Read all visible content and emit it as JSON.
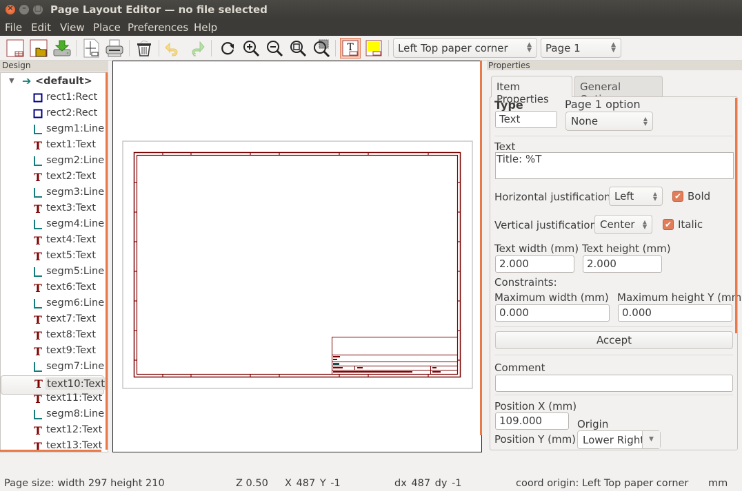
{
  "window": {
    "title": "Page Layout Editor — no file selected",
    "close": "×",
    "minimize": "–",
    "maximize": "□"
  },
  "menu": [
    "File",
    "Edit",
    "View",
    "Place",
    "Preferences",
    "Help"
  ],
  "toolbar": {
    "buttons": [
      {
        "name": "new-page-layout",
        "icon": "new-layout-icon"
      },
      {
        "name": "open-page-layout",
        "icon": "folder-icon"
      },
      {
        "name": "save-page-layout",
        "icon": "save-disk-icon"
      },
      {
        "name": "page-settings",
        "icon": "page-settings-icon"
      },
      {
        "name": "print",
        "icon": "printer-icon"
      },
      {
        "name": "delete-item",
        "icon": "trash-icon"
      },
      {
        "name": "undo",
        "icon": "undo-icon",
        "disabled": true
      },
      {
        "name": "redo",
        "icon": "redo-icon",
        "disabled": true
      },
      {
        "name": "redraw",
        "icon": "redraw-icon"
      },
      {
        "name": "zoom-in",
        "icon": "zoom-in-icon"
      },
      {
        "name": "zoom-out",
        "icon": "zoom-out-icon"
      },
      {
        "name": "zoom-fit",
        "icon": "zoom-fit-icon"
      },
      {
        "name": "zoom-selection",
        "icon": "zoom-selection-icon"
      },
      {
        "name": "show-page-layout-text",
        "icon": "text-layout-icon",
        "active": true
      },
      {
        "name": "show-colored-preview",
        "icon": "color-preview-icon"
      }
    ],
    "origin_combo": "Left Top paper corner",
    "page_combo": "Page 1"
  },
  "design": {
    "title": "Design",
    "root": "<default>",
    "items": [
      {
        "label": "rect1:Rect",
        "type": "rect"
      },
      {
        "label": "rect2:Rect",
        "type": "rect"
      },
      {
        "label": "segm1:Line",
        "type": "line"
      },
      {
        "label": "text1:Text",
        "type": "text"
      },
      {
        "label": "segm2:Line",
        "type": "line"
      },
      {
        "label": "text2:Text",
        "type": "text"
      },
      {
        "label": "segm3:Line",
        "type": "line"
      },
      {
        "label": "text3:Text",
        "type": "text"
      },
      {
        "label": "segm4:Line",
        "type": "line"
      },
      {
        "label": "text4:Text",
        "type": "text"
      },
      {
        "label": "text5:Text",
        "type": "text"
      },
      {
        "label": "segm5:Line",
        "type": "line"
      },
      {
        "label": "text6:Text",
        "type": "text"
      },
      {
        "label": "segm6:Line",
        "type": "line"
      },
      {
        "label": "text7:Text",
        "type": "text"
      },
      {
        "label": "text8:Text",
        "type": "text"
      },
      {
        "label": "text9:Text",
        "type": "text"
      },
      {
        "label": "segm7:Line",
        "type": "line"
      },
      {
        "label": "text10:Text",
        "type": "text",
        "selected": true
      },
      {
        "label": "text11:Text",
        "type": "text"
      },
      {
        "label": "segm8:Line",
        "type": "line"
      },
      {
        "label": "text12:Text",
        "type": "text"
      },
      {
        "label": "text13:Text",
        "type": "text"
      }
    ]
  },
  "properties": {
    "title": "Properties",
    "tabs": [
      "Item Properties",
      "General Options"
    ],
    "type_label": "Type",
    "type_value": "Text",
    "page1_label": "Page 1 option",
    "page1_value": "None",
    "text_label": "Text",
    "text_value": "Title: %T",
    "hjust_label": "Horizontal justification",
    "hjust_value": "Left",
    "bold_label": "Bold",
    "bold_checked": true,
    "vjust_label": "Vertical justification",
    "vjust_value": "Center",
    "italic_label": "Italic",
    "italic_checked": true,
    "text_width_label": "Text width (mm)",
    "text_width_value": "2.000",
    "text_height_label": "Text height (mm)",
    "text_height_value": "2.000",
    "constraints_label": "Constraints:",
    "max_width_label": "Maximum width (mm)",
    "max_width_value": "0.000",
    "max_height_label": "Maximum height Y (mm)",
    "max_height_value": "0.000",
    "accept_label": "Accept",
    "comment_label": "Comment",
    "comment_value": "",
    "posx_label": "Position X (mm)",
    "posx_value": "109.000",
    "origin_label": "Origin",
    "origin_value": "Lower Right",
    "posy_label": "Position Y (mm)"
  },
  "status": {
    "page_size": "Page size: width 297 height 210",
    "zoom": "Z 0.50",
    "xy": "X 487  Y -1",
    "dxdy": "dx 487  dy -1",
    "coord_origin": "coord origin: Left Top paper corner",
    "units": "mm"
  },
  "colors": {
    "accent": "#e8794a",
    "frame": "#7a0000",
    "line_icon": "#127d7d",
    "rect_icon": "#000080"
  }
}
